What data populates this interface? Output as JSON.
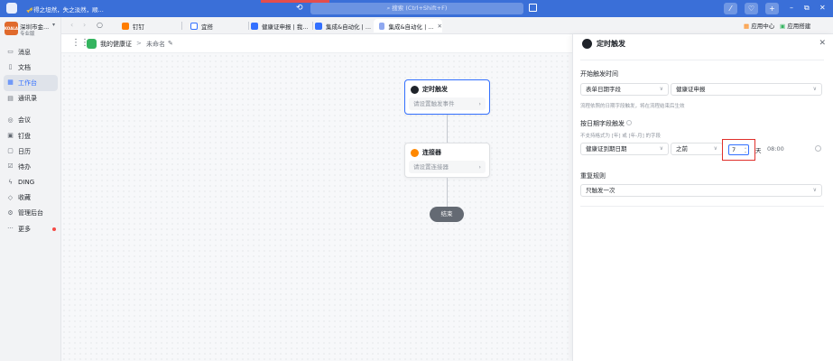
{
  "topbar": {
    "title": "🎺得之坦然，失之淡然，顺...",
    "search_placeholder": "搜索 (Ctrl+Shift+F)"
  },
  "sidebar": {
    "org_name": "深圳市金...",
    "org_sub": "专业版",
    "logo_text": "KOALA",
    "items": [
      {
        "label": "消息",
        "icon": "message-icon"
      },
      {
        "label": "文档",
        "icon": "doc-icon"
      },
      {
        "label": "工作台",
        "icon": "workbench-icon",
        "active": true
      },
      {
        "label": "通讯录",
        "icon": "contacts-icon"
      },
      {
        "label": "会议",
        "icon": "meeting-icon"
      },
      {
        "label": "钉盘",
        "icon": "drive-icon"
      },
      {
        "label": "日历",
        "icon": "calendar-icon"
      },
      {
        "label": "待办",
        "icon": "todo-icon"
      },
      {
        "label": "DING",
        "icon": "ding-icon"
      },
      {
        "label": "收藏",
        "icon": "favorite-icon"
      },
      {
        "label": "管理后台",
        "icon": "admin-icon"
      },
      {
        "label": "更多",
        "icon": "more-icon",
        "badge": true
      }
    ]
  },
  "tabs": [
    {
      "label": "钉钉",
      "color": "#ff7d00"
    },
    {
      "label": "宜搭",
      "color": "#ffffff"
    },
    {
      "label": "健康证申报 | 我...",
      "color": "#3370ff"
    },
    {
      "label": "集成&自动化 | ...",
      "color": "#3370ff"
    },
    {
      "label": "集成&自动化 | ...",
      "color": "#8fa8f0",
      "active": true
    }
  ],
  "tab_right": {
    "app_center": "应用中心",
    "app_mgmt": "应用搭建"
  },
  "breadcrumb": {
    "app_name": "我的健康证",
    "separator": ">",
    "current": "未命名"
  },
  "flow": {
    "trigger": {
      "title": "定时触发",
      "placeholder": "请设置触发事件",
      "color": "#1f2329"
    },
    "connector": {
      "title": "连接器",
      "placeholder": "请设置连接器",
      "color": "#ff8800"
    },
    "end": "结束"
  },
  "panel": {
    "title": "定时触发",
    "start_time_label": "开始触发时间",
    "form_field_type": "表单日期字段",
    "form_name": "健康证申报",
    "start_hint": "流程依照的日期字段触发，将在流程结束后生效",
    "date_trigger_label": "按日期字段触发",
    "date_trigger_hint": "不支持格式为 [年] 或 [年-月] 的字段",
    "date_field": "健康证到期日期",
    "direction": "之前",
    "days_value": "7",
    "days_unit": "天",
    "time": "08:00",
    "repeat_label": "重复规则",
    "repeat_value": "只触发一次"
  }
}
